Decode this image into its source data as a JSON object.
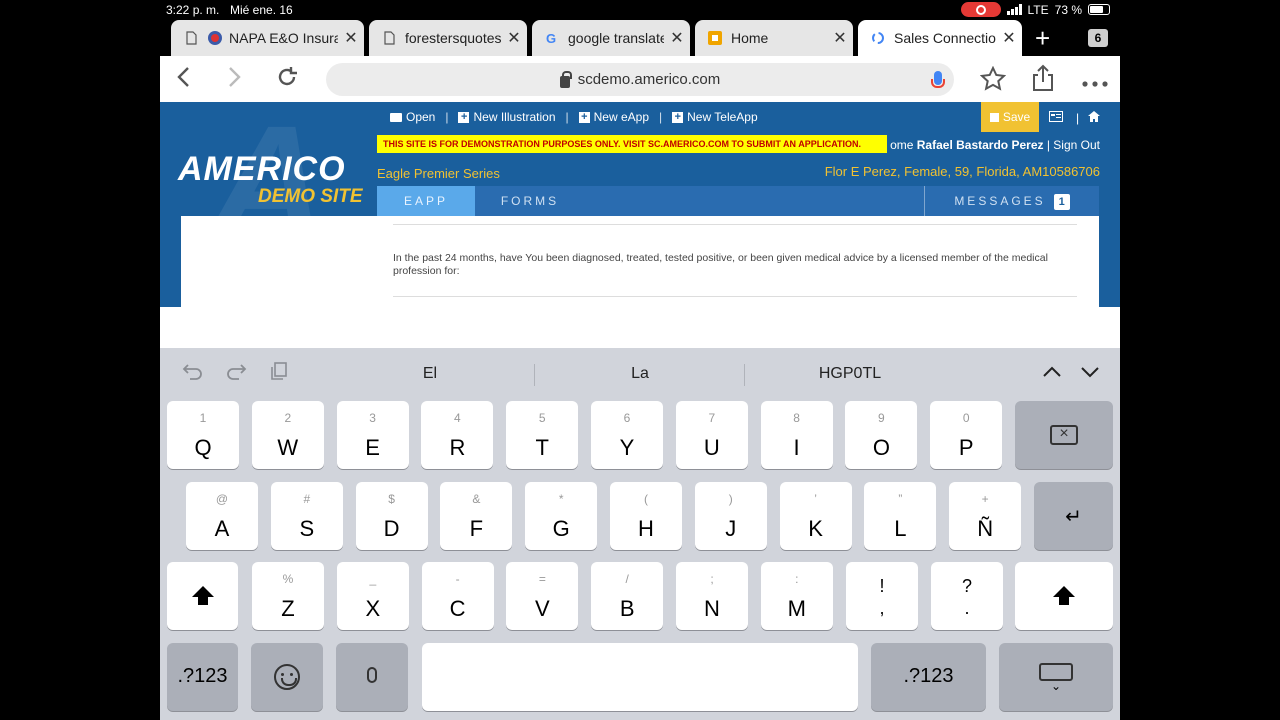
{
  "status": {
    "time": "3:22 p. m.",
    "date": "Mié ene. 16",
    "network": "LTE",
    "battery": "73 %",
    "battery_level": 0.73
  },
  "tabs": [
    {
      "label": "NAPA E&O Insura",
      "icon": "seal-icon",
      "active": false
    },
    {
      "label": "forestersquotes.",
      "icon": "page-icon",
      "active": false
    },
    {
      "label": "google translate -",
      "icon": "google-icon",
      "active": false
    },
    {
      "label": "Home",
      "icon": "home-favicon",
      "active": false
    },
    {
      "label": "Sales Connection",
      "icon": "loading-icon",
      "active": true
    }
  ],
  "tab_count": "6",
  "url": "scdemo.americo.com",
  "site": {
    "logo_main": "AMERICO",
    "logo_sub": "DEMO SITE",
    "watermark": "A",
    "toolbar": {
      "open": "Open",
      "new_illustration": "New Illustration",
      "new_eapp": "New eApp",
      "new_teleapp": "New TeleApp",
      "save": "Save"
    },
    "demo_banner": "THIS SITE IS FOR DEMONSTRATION PURPOSES ONLY. VISIT SC.AMERICO.COM TO SUBMIT AN APPLICATION.",
    "welcome_prefix": "ome",
    "user_name": "Rafael Bastardo Perez",
    "sign_out": "Sign Out",
    "series": "Eagle Premier Series",
    "client": "Flor E Perez, Female, 59, Florida, AM10586706",
    "tab_eapp": "EAPP",
    "tab_forms": "FORMS",
    "tab_messages": "MESSAGES",
    "messages_count": "1",
    "question": "In the past 24 months, have You been diagnosed, treated, tested positive, or been given medical advice by a licensed member of the medical profession for:"
  },
  "keyboard": {
    "suggestions": [
      "El",
      "La",
      "HGP0TL"
    ],
    "row1": [
      {
        "hint": "1",
        "key": "Q"
      },
      {
        "hint": "2",
        "key": "W"
      },
      {
        "hint": "3",
        "key": "E"
      },
      {
        "hint": "4",
        "key": "R"
      },
      {
        "hint": "5",
        "key": "T"
      },
      {
        "hint": "6",
        "key": "Y"
      },
      {
        "hint": "7",
        "key": "U"
      },
      {
        "hint": "8",
        "key": "I"
      },
      {
        "hint": "9",
        "key": "O"
      },
      {
        "hint": "0",
        "key": "P"
      }
    ],
    "row2": [
      {
        "hint": "@",
        "key": "A"
      },
      {
        "hint": "#",
        "key": "S"
      },
      {
        "hint": "$",
        "key": "D"
      },
      {
        "hint": "&",
        "key": "F"
      },
      {
        "hint": "*",
        "key": "G"
      },
      {
        "hint": "(",
        "key": "H"
      },
      {
        "hint": ")",
        "key": "J"
      },
      {
        "hint": "’",
        "key": "K"
      },
      {
        "hint": "”",
        "key": "L"
      },
      {
        "hint": "+",
        "key": "Ñ"
      }
    ],
    "row3": [
      {
        "hint": "%",
        "key": "Z"
      },
      {
        "hint": "_",
        "key": "X"
      },
      {
        "hint": "-",
        "key": "C"
      },
      {
        "hint": "=",
        "key": "V"
      },
      {
        "hint": "/",
        "key": "B"
      },
      {
        "hint": ";",
        "key": "N"
      },
      {
        "hint": ":",
        "key": "M"
      }
    ],
    "punct1": {
      "top": "!",
      "bottom": ","
    },
    "punct2": {
      "top": "?",
      "bottom": "."
    },
    "numbers_key": ".?123"
  }
}
